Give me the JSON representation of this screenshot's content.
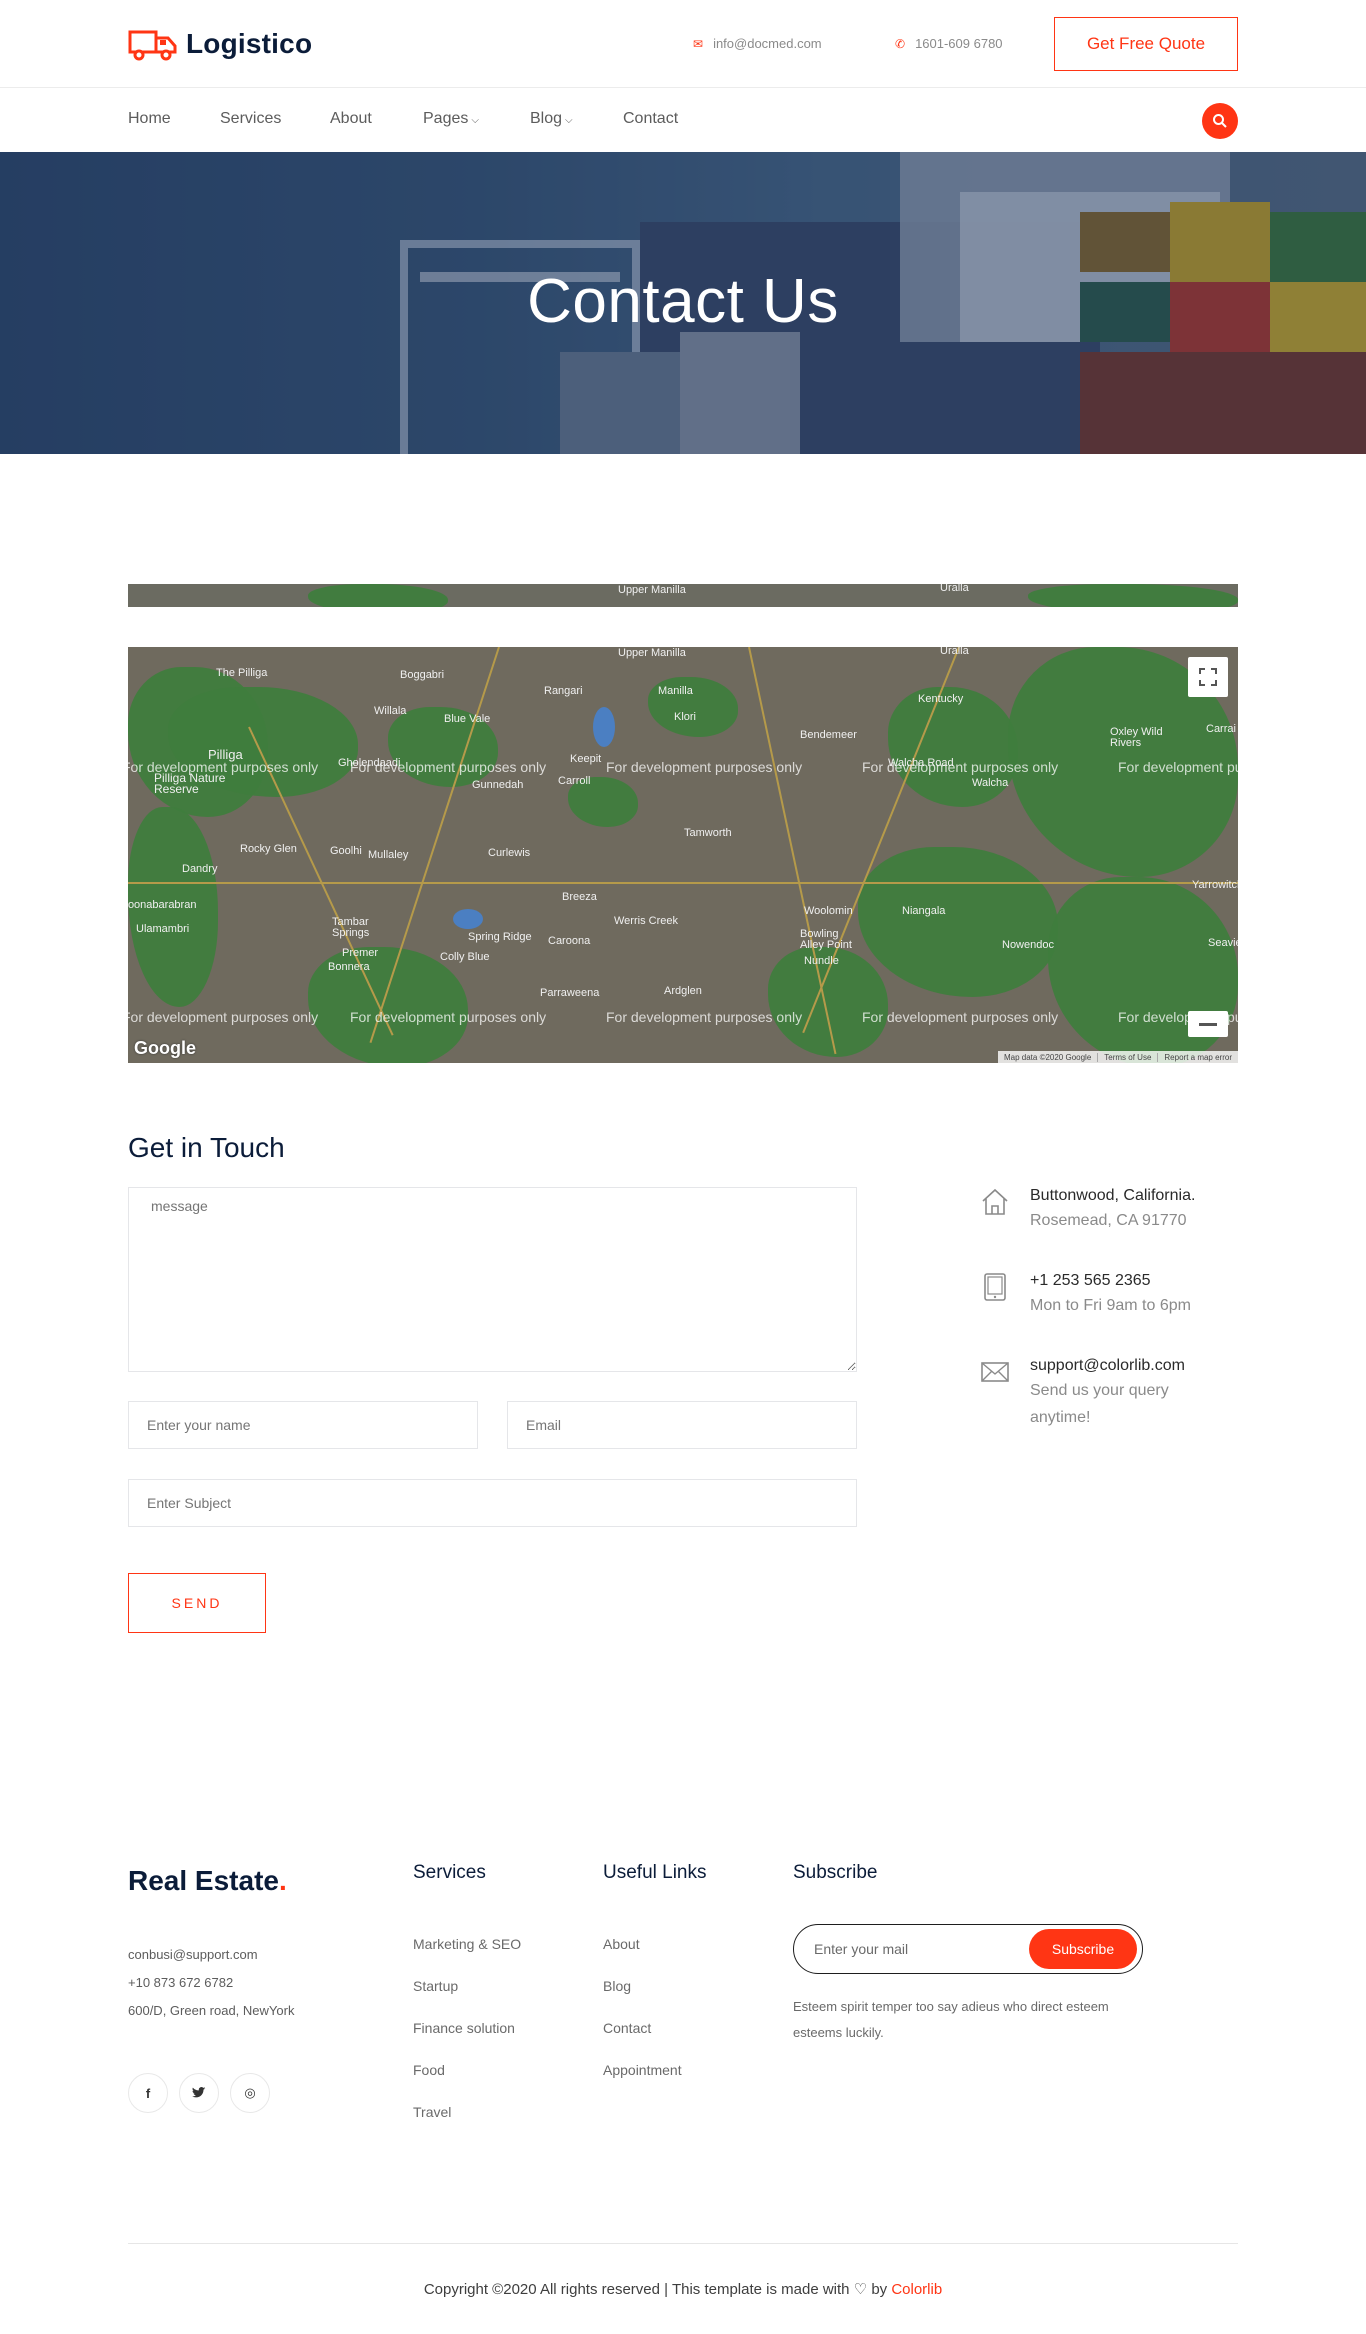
{
  "header": {
    "logo_text": "Logistico",
    "email": "info@docmed.com",
    "phone": "1601-609 6780",
    "quote_label": "Get Free Quote"
  },
  "nav": {
    "items": [
      {
        "label": "Home"
      },
      {
        "label": "Services"
      },
      {
        "label": "About"
      },
      {
        "label": "Pages",
        "dropdown": true
      },
      {
        "label": "Blog",
        "dropdown": true
      },
      {
        "label": "Contact"
      }
    ]
  },
  "hero": {
    "title": "Contact Us"
  },
  "map": {
    "places": [
      "Upper Manilla",
      "Uralla",
      "The Pilliga",
      "Boggabri",
      "Rangari",
      "Manilla",
      "Kentucky",
      "Willala",
      "Blue Vale",
      "Klori",
      "Bendemeer",
      "Oxley Wild Rivers",
      "Carrai",
      "Pilliga",
      "Keepit",
      "Walcha Road",
      "Gunnedah",
      "Carroll",
      "Walcha",
      "Pilliga Nature Reserve",
      "Gholendaadi",
      "Tamworth",
      "Rocky Glen",
      "Goolhi",
      "Mullaley",
      "Curlewis",
      "Dandry",
      "Yarrowitch",
      "Breeza",
      "Woolomin",
      "Niangala",
      "Werris Creek",
      "Coonabarabran",
      "Ulamambri",
      "Tambar Springs",
      "Spring Ridge",
      "Bowling Alley Point",
      "Nowendoc",
      "Caroona",
      "Premer",
      "Colly Blue",
      "Nundle",
      "Bonnera",
      "Parraweena",
      "Ardglen",
      "Seaview"
    ],
    "dev_notice": "For development purposes only",
    "google_label": "Google",
    "footer": [
      "Map data ©2020 Google",
      "Terms of Use",
      "Report a map error"
    ]
  },
  "contact": {
    "title": "Get in Touch",
    "message_placeholder": "message",
    "name_placeholder": "Enter your name",
    "email_placeholder": "Email",
    "subject_placeholder": "Enter Subject",
    "send_label": "SEND",
    "info": [
      {
        "title": "Buttonwood, California.",
        "sub": "Rosemead, CA 91770",
        "icon": "home-icon"
      },
      {
        "title": "+1 253 565 2365",
        "sub": "Mon to Fri 9am to 6pm",
        "icon": "tablet-icon"
      },
      {
        "title": "support@colorlib.com",
        "sub": "Send us your query anytime!",
        "icon": "envelope-icon"
      }
    ]
  },
  "footer": {
    "brand": "Real Estate",
    "brand_dot": ".",
    "email": "conbusi@support.com",
    "phone": "+10 873 672 6782",
    "address": "600/D, Green road, NewYork",
    "social": [
      {
        "icon": "facebook-icon",
        "glyph": "f"
      },
      {
        "icon": "twitter-icon",
        "glyph": "t"
      },
      {
        "icon": "instagram-icon",
        "glyph": "◎"
      }
    ],
    "services_title": "Services",
    "services": [
      "Marketing & SEO",
      "Startup",
      "Finance solution",
      "Food",
      "Travel"
    ],
    "links_title": "Useful Links",
    "links": [
      "About",
      "Blog",
      "Contact",
      "Appointment"
    ],
    "subscribe_title": "Subscribe",
    "subscribe_placeholder": "Enter your mail",
    "subscribe_button": "Subscribe",
    "subscribe_text": "Esteem spirit temper too say adieus who direct esteem esteems luckily.",
    "copyright_prefix": "Copyright ©2020 All rights reserved | This template is made with",
    "copyright_by": "by",
    "copyright_brand": "Colorlib"
  },
  "colors": {
    "accent": "#ff3514",
    "heading": "#0b1c39",
    "text_muted": "#8a8a8a"
  }
}
